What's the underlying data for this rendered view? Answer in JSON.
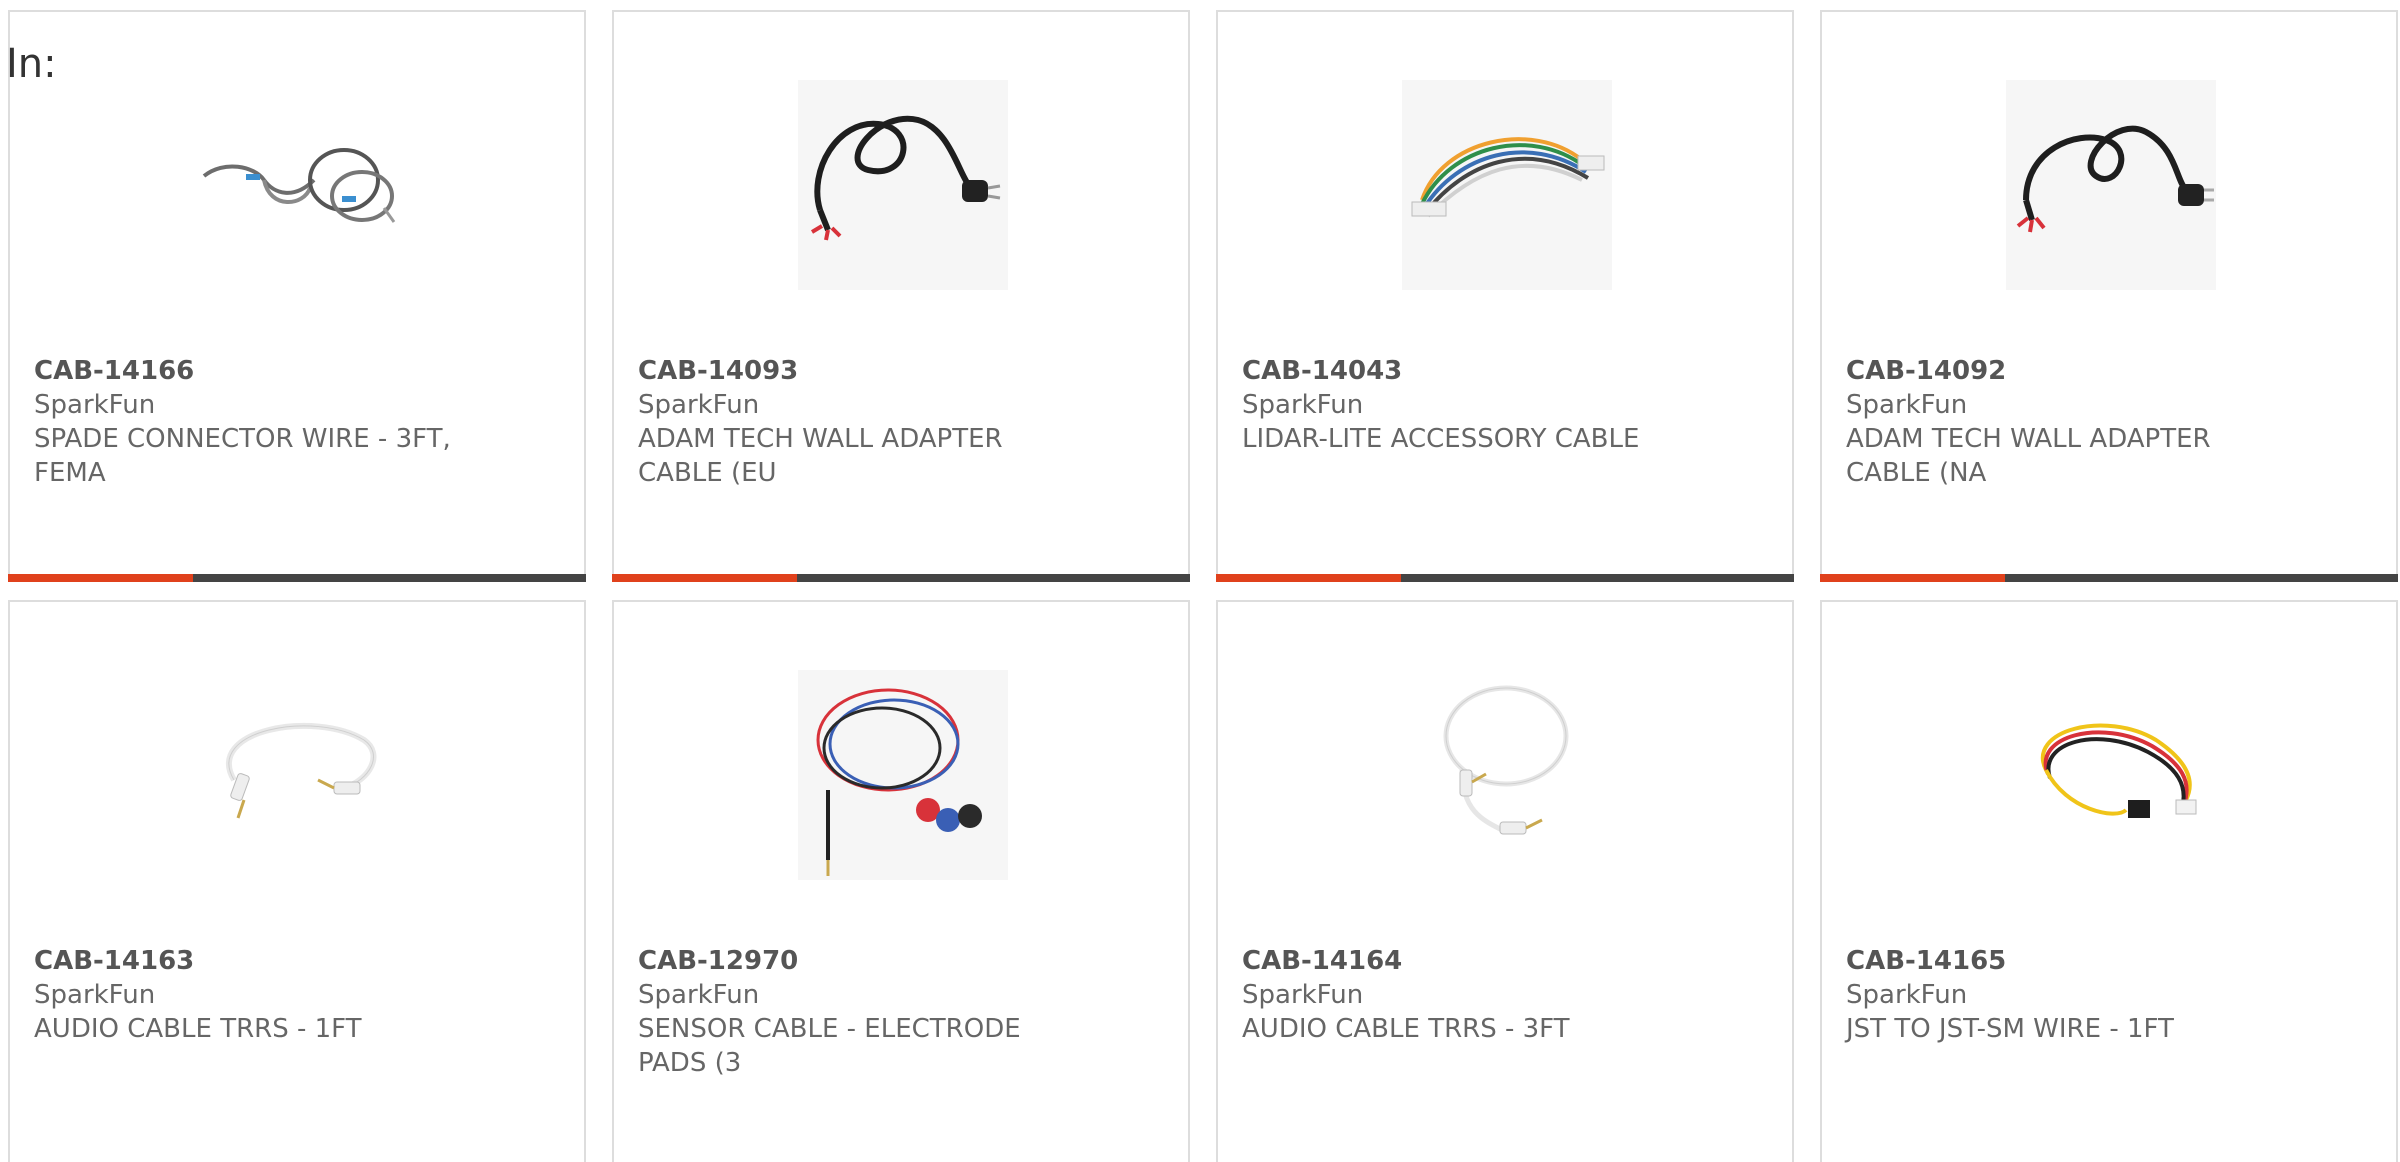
{
  "filter": {
    "label": "In:"
  },
  "colors": {
    "accent": "#e0411c",
    "bar_track": "#444444",
    "card_border": "#dddddd",
    "text": "#555555"
  },
  "products": [
    {
      "sku": "CAB-14166",
      "brand": "SparkFun",
      "name_line1": "SPADE CONNECTOR WIRE - 3FT,",
      "name_line2": "FEMA",
      "image": "spade-connector-wire-image",
      "bar_fill": 0.32
    },
    {
      "sku": "CAB-14093",
      "brand": "SparkFun",
      "name_line1": "ADAM TECH WALL ADAPTER",
      "name_line2": "CABLE (EU",
      "image": "wall-adapter-cable-eu-image",
      "bar_fill": 0.32
    },
    {
      "sku": "CAB-14043",
      "brand": "SparkFun",
      "name_line1": "LIDAR-LITE ACCESSORY CABLE",
      "name_line2": "",
      "image": "lidar-lite-cable-image",
      "bar_fill": 0.32
    },
    {
      "sku": "CAB-14092",
      "brand": "SparkFun",
      "name_line1": "ADAM TECH WALL ADAPTER",
      "name_line2": "CABLE (NA",
      "image": "wall-adapter-cable-na-image",
      "bar_fill": 0.32
    },
    {
      "sku": "CAB-14163",
      "brand": "SparkFun",
      "name_line1": "AUDIO CABLE TRRS - 1FT",
      "name_line2": "",
      "image": "audio-cable-1ft-image"
    },
    {
      "sku": "CAB-12970",
      "brand": "SparkFun",
      "name_line1": "SENSOR CABLE - ELECTRODE",
      "name_line2": "PADS (3",
      "image": "sensor-cable-electrode-image"
    },
    {
      "sku": "CAB-14164",
      "brand": "SparkFun",
      "name_line1": "AUDIO CABLE TRRS - 3FT",
      "name_line2": "",
      "image": "audio-cable-3ft-image"
    },
    {
      "sku": "CAB-14165",
      "brand": "SparkFun",
      "name_line1": "JST TO JST-SM WIRE - 1FT",
      "name_line2": "",
      "image": "jst-wire-image"
    }
  ]
}
